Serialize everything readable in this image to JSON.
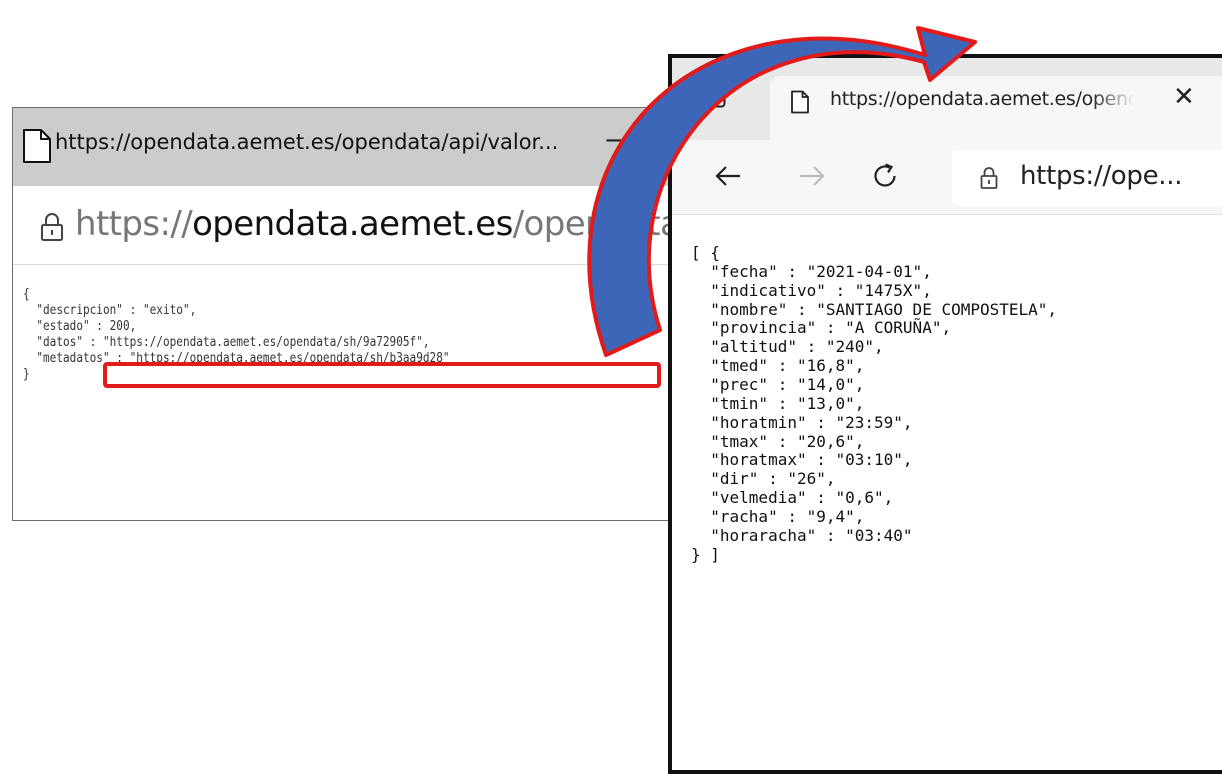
{
  "left_window": {
    "title": "https://opendata.aemet.es/opendata/api/valor...",
    "minimize_glyph": "—",
    "address": {
      "scheme": "https://",
      "host": "opendata.aemet.es",
      "path": "/opendata/api"
    },
    "json_lines": [
      "{",
      "  \"descripcion\" : \"exito\",",
      "  \"estado\" : 200,",
      "  \"datos\" : \"https://opendata.aemet.es/opendata/sh/9a72905f\",",
      "  \"metadatos\" : \"https://opendata.aemet.es/opendata/sh/b3aa9d28\"",
      "}"
    ]
  },
  "right_window": {
    "tab_title": "https://opendata.aemet.es/opendata/api/valores",
    "tab_close_glyph": "✕",
    "address": "https://ope...",
    "json_lines": [
      "[ {",
      "  \"fecha\" : \"2021-04-01\",",
      "  \"indicativo\" : \"1475X\",",
      "  \"nombre\" : \"SANTIAGO DE COMPOSTELA\",",
      "  \"provincia\" : \"A CORUÑA\",",
      "  \"altitud\" : \"240\",",
      "  \"tmed\" : \"16,8\",",
      "  \"prec\" : \"14,0\",",
      "  \"tmin\" : \"13,0\",",
      "  \"horatmin\" : \"23:59\",",
      "  \"tmax\" : \"20,6\",",
      "  \"horatmax\" : \"03:10\",",
      "  \"dir\" : \"26\",",
      "  \"velmedia\" : \"0,6\",",
      "  \"racha\" : \"9,4\",",
      "  \"horaracha\" : \"03:40\"",
      "} ]"
    ]
  },
  "icons": {
    "left_doc": "document-icon",
    "left_lock": "lock-icon",
    "right_tab_actions": "tab-actions-icon",
    "right_doc": "document-icon",
    "back": "arrow-left-icon",
    "forward": "arrow-right-icon",
    "refresh": "refresh-icon",
    "lock": "lock-icon"
  },
  "colors": {
    "highlight_border": "#e21a1a",
    "arrow_fill": "#3d66b8",
    "arrow_stroke": "#e21a1a",
    "title_bar_gray": "#cccccc",
    "tab_strip_gray": "#e8e8e8"
  }
}
